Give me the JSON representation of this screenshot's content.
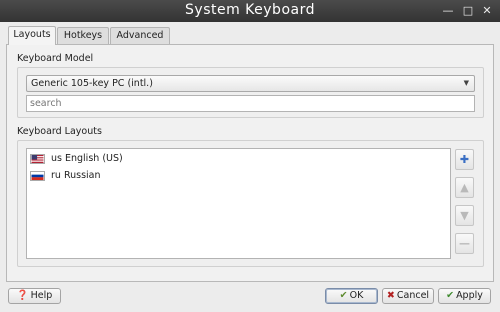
{
  "window": {
    "title": "System Keyboard"
  },
  "tabs": [
    {
      "label": "Layouts",
      "active": true
    },
    {
      "label": "Hotkeys",
      "active": false
    },
    {
      "label": "Advanced",
      "active": false
    }
  ],
  "keyboard_model": {
    "section_label": "Keyboard Model",
    "selected": "Generic 105-key PC (intl.)",
    "search_placeholder": "search"
  },
  "keyboard_layouts": {
    "section_label": "Keyboard Layouts",
    "items": [
      {
        "code": "us",
        "name": "English (US)",
        "label": "us English (US)",
        "flag": "flag-us-icon"
      },
      {
        "code": "ru",
        "name": "Russian",
        "label": "ru Russian",
        "flag": "flag-ru-icon"
      }
    ],
    "side_buttons": {
      "add": "plus-icon",
      "move_up": "arrow-up-icon",
      "move_down": "arrow-down-icon",
      "remove": "minus-icon"
    }
  },
  "footer": {
    "help_label": "Help",
    "ok_label": "OK",
    "cancel_label": "Cancel",
    "apply_label": "Apply"
  },
  "colors": {
    "titlebar": "#3c3c3c",
    "add_icon": "#3a6fc4",
    "disabled_icon": "#b9b9b9",
    "ok_icon": "#5d8a2d",
    "cancel_icon": "#b22222",
    "apply_icon": "#3e8a2e",
    "help_icon": "#3a6fc4"
  }
}
